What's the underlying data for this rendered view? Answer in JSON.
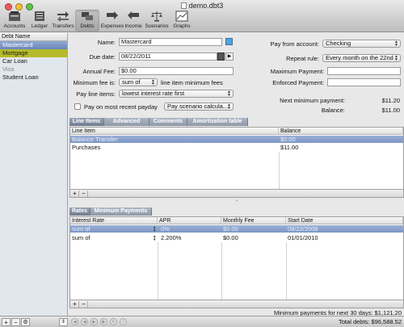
{
  "window": {
    "title": "demo.dbt3"
  },
  "toolbar": {
    "items": [
      {
        "label": "Accounts"
      },
      {
        "label": "Ledger"
      },
      {
        "label": "Transfers"
      },
      {
        "label": "Debts"
      },
      {
        "label": "Expenses"
      },
      {
        "label": "Income"
      },
      {
        "label": "Scenarios"
      },
      {
        "label": "Graphs"
      }
    ],
    "active": "Debts"
  },
  "sidebar": {
    "header": "Debt Name",
    "items": [
      {
        "label": "Mastercard",
        "state": "selected"
      },
      {
        "label": "Mortgage",
        "state": "highlighted"
      },
      {
        "label": "Car Loan",
        "state": "normal"
      },
      {
        "label": "Visa",
        "state": "dimmed"
      },
      {
        "label": "Student Loan",
        "state": "normal"
      }
    ]
  },
  "form": {
    "name_label": "Name:",
    "name_value": "Mastercard",
    "due_date_label": "Due date:",
    "due_date_value": "08/22/2011",
    "annual_fee_label": "Annual Fee:",
    "annual_fee_value": "$0.00",
    "min_fee_label": "Minimum fee is:",
    "min_fee_value": "sum of",
    "min_fee_suffix": "line item minimum fees",
    "pay_line_items_label": "Pay line items:",
    "pay_line_items_value": "lowest interest rate first",
    "pay_recent_label": "Pay on most recent payday",
    "pay_scenario_value": "Pay scenario calcula...",
    "pay_from_label": "Pay from account:",
    "pay_from_value": "Checking",
    "repeat_label": "Repeat rule:",
    "repeat_value": "Every month on the 22nd",
    "max_payment_label": "Maximum Payment:",
    "max_payment_value": "",
    "enforced_payment_label": "Enforced Payment:",
    "enforced_payment_value": "",
    "next_min_label": "Next minimum payment:",
    "next_min_value": "$11.20",
    "balance_label": "Balance:",
    "balance_value": "$11.00"
  },
  "line_items_tabs": [
    "Line Items",
    "Advanced options",
    "Comments",
    "Amortization table"
  ],
  "line_items": {
    "columns": [
      "Line Item",
      "Balance"
    ],
    "rows": [
      {
        "item": "Balance Transfer",
        "balance": "$0.00",
        "selected": true
      },
      {
        "item": "Purchases",
        "balance": "$11.00",
        "selected": false
      }
    ],
    "add_label": "+",
    "remove_label": "−"
  },
  "rates_tabs": [
    "Rates",
    "Minimum Payments"
  ],
  "rates": {
    "columns": [
      "Interest Rate",
      "APR",
      "Monthly Fee",
      "Start Date"
    ],
    "rows": [
      {
        "rate": "sum of",
        "apr": "0%",
        "fee": "$0.00",
        "start": "08/22/2008",
        "selected": true
      },
      {
        "rate": "sum of",
        "apr": "2.200%",
        "fee": "$0.00",
        "start": "01/01/2010",
        "selected": false
      }
    ],
    "add_label": "+",
    "remove_label": "−"
  },
  "footer": {
    "min_payments_text": "Minimum payments for next 30 days: $1,121.20",
    "total_debts_text": "Total debts: $96,588.52"
  },
  "colors": {
    "selection": "#7d96c6",
    "highlight": "#b6ba2a",
    "tab": "#8e98a8",
    "swatch": "#4aa5e0"
  }
}
